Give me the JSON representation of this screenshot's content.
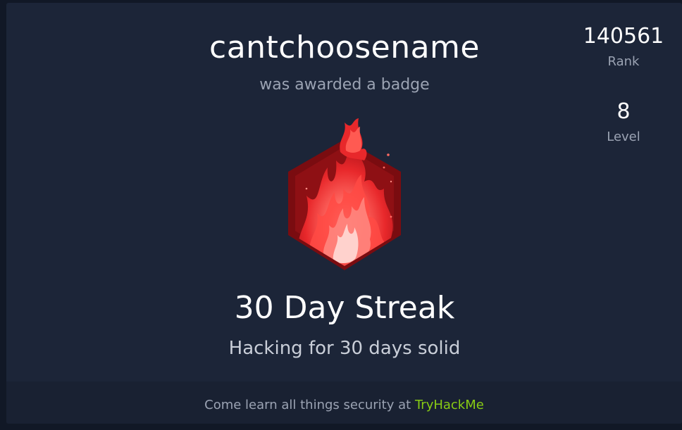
{
  "card": {
    "username": "cantchoosename",
    "subtitle": "was awarded a badge"
  },
  "stats": {
    "rank": {
      "value": "140561",
      "label": "Rank"
    },
    "level": {
      "value": "8",
      "label": "Level"
    }
  },
  "badge": {
    "icon": "fire-badge-icon",
    "title": "30 Day Streak",
    "description": "Hacking for 30 days solid"
  },
  "footer": {
    "text": "Come learn all things security at",
    "link_text": "TryHackMe"
  },
  "colors": {
    "page_bg": "#111826",
    "card_bg": "#1c2538",
    "footer_bg": "#192132",
    "accent_link": "#88cc14",
    "badge_dark": "#7a0c10",
    "badge_flame": "#e8282b"
  }
}
